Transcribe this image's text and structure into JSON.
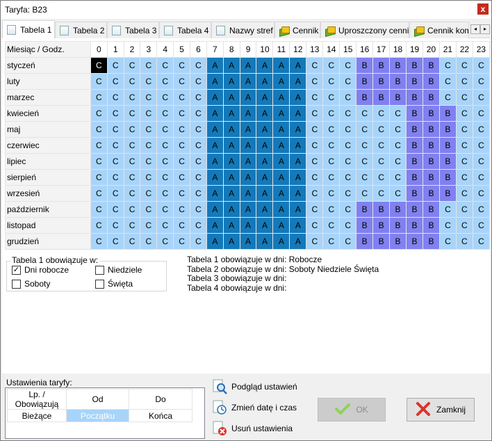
{
  "window": {
    "title": "Taryfa: B23",
    "close_glyph": "x"
  },
  "tabs": [
    {
      "label": "Tabela 1",
      "icon": "document-icon",
      "active": true
    },
    {
      "label": "Tabela 2",
      "icon": "document-icon"
    },
    {
      "label": "Tabela 3",
      "icon": "document-icon"
    },
    {
      "label": "Tabela 4",
      "icon": "document-icon"
    },
    {
      "label": "Nazwy stref",
      "icon": "document-icon"
    },
    {
      "label": "Cennik",
      "icon": "money-icon"
    },
    {
      "label": "Uproszczony cennik",
      "icon": "money-icon"
    },
    {
      "label": "Cennik komu",
      "icon": "money-icon"
    }
  ],
  "tab_scroll": {
    "left": "◂",
    "right": "▸"
  },
  "grid": {
    "header_label": "Miesiąc / Godz.",
    "hours": [
      "0",
      "1",
      "2",
      "3",
      "4",
      "5",
      "6",
      "7",
      "8",
      "9",
      "10",
      "11",
      "12",
      "13",
      "14",
      "15",
      "16",
      "17",
      "18",
      "19",
      "20",
      "21",
      "22",
      "23"
    ],
    "rows": [
      {
        "month": "styczeń",
        "cells": "CCCCCCCAAAAAACCCBBBBBCCC"
      },
      {
        "month": "luty",
        "cells": "CCCCCCCAAAAAACCCBBBBBCCC"
      },
      {
        "month": "marzec",
        "cells": "CCCCCCCAAAAAACCCBBBBBCCC"
      },
      {
        "month": "kwiecień",
        "cells": "CCCCCCCAAAAAACCCCCCBBBCC"
      },
      {
        "month": "maj",
        "cells": "CCCCCCCAAAAAACCCCCCBBBCC"
      },
      {
        "month": "czerwiec",
        "cells": "CCCCCCCAAAAAACCCCCCBBBCC"
      },
      {
        "month": "lipiec",
        "cells": "CCCCCCCAAAAAACCCCCCBBBCC"
      },
      {
        "month": "sierpień",
        "cells": "CCCCCCCAAAAAACCCCCCBBBCC"
      },
      {
        "month": "wrzesień",
        "cells": "CCCCCCCAAAAAACCCCCCBBBCC"
      },
      {
        "month": "październik",
        "cells": "CCCCCCCAAAAAACCCBBBBBCCC"
      },
      {
        "month": "listopad",
        "cells": "CCCCCCCAAAAAACCCBBBBBCCC"
      },
      {
        "month": "grudzień",
        "cells": "CCCCCCCAAAAAACCCBBBBBCCC"
      }
    ],
    "selected": {
      "row": 0,
      "col": 0
    },
    "zone_colors": {
      "A": "#1479b9",
      "B": "#8080f0",
      "C": "#a8d4fa"
    }
  },
  "applies": {
    "group_label": "Tabela 1 obowiązuje w:",
    "options": [
      {
        "label": "Dni robocze",
        "checked": true
      },
      {
        "label": "Niedziele",
        "checked": false
      },
      {
        "label": "Soboty",
        "checked": false
      },
      {
        "label": "Święta",
        "checked": false
      }
    ]
  },
  "info_lines": [
    "Tabela 1 obowiązuje w dni: Robocze",
    "Tabela 2 obowiązuje w dni: Soboty Niedziele Święta",
    "Tabela 3 obowiązuje w dni:",
    "Tabela 4 obowiązuje w dni:"
  ],
  "settings": {
    "label": "Ustawienia taryfy:",
    "columns": [
      "Lp. / Obowiązują",
      "Od",
      "Do"
    ],
    "row": [
      "Bieżące",
      "Początku",
      "Końca"
    ]
  },
  "actions": {
    "preview": "Podgląd ustawień",
    "change_date": "Zmień datę i czas",
    "delete": "Usuń ustawienia",
    "ok": "OK",
    "close": "Zamknij"
  }
}
